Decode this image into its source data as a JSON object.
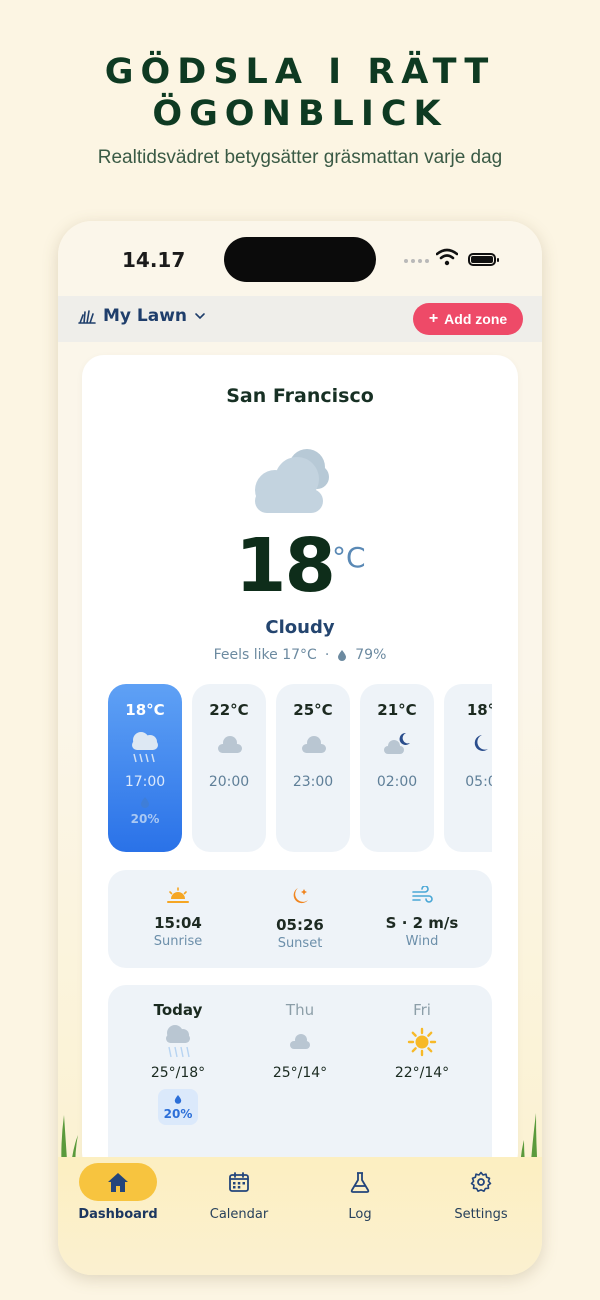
{
  "header": {
    "title_line1": "GÖDSLA I RÄTT",
    "title_line2": "ÖGONBLICK",
    "subtitle": "Realtidsvädret betygsätter gräsmattan varje dag"
  },
  "status_bar": {
    "time": "14.17"
  },
  "top_bar": {
    "lawn_name": "My Lawn",
    "add_zone_label": "Add zone",
    "icons": [
      "lawn-icon",
      "chevron-down-icon",
      "plus-icon"
    ]
  },
  "weather": {
    "city": "San Francisco",
    "temperature": "18",
    "unit": "°C",
    "condition": "Cloudy",
    "feels_like": "Feels like 17°C",
    "separator": "·",
    "humidity": "79%"
  },
  "hourly": [
    {
      "temp": "18°C",
      "time": "17:00",
      "precip": "20%",
      "icon": "rain-cloud-icon",
      "active": true
    },
    {
      "temp": "22°C",
      "time": "20:00",
      "icon": "cloud-icon"
    },
    {
      "temp": "25°C",
      "time": "23:00",
      "icon": "cloud-icon"
    },
    {
      "temp": "21°C",
      "time": "02:00",
      "icon": "cloud-moon-icon"
    },
    {
      "temp": "18°",
      "time": "05:0",
      "icon": "moon-icon"
    }
  ],
  "sun_wind": [
    {
      "value": "15:04",
      "label": "Sunrise",
      "icon": "sunrise-icon"
    },
    {
      "value": "05:26",
      "label": "Sunset",
      "icon": "sunset-icon"
    },
    {
      "value": "S · 2 m/s",
      "label": "Wind",
      "icon": "wind-icon"
    }
  ],
  "daily": [
    {
      "day": "Today",
      "temps": "25°/18°",
      "precip": "20%",
      "icon": "rain-cloud-icon"
    },
    {
      "day": "Thu",
      "temps": "25°/14°",
      "icon": "cloud-icon"
    },
    {
      "day": "Fri",
      "temps": "22°/14°",
      "icon": "sun-icon"
    }
  ],
  "tabs": [
    {
      "label": "Dashboard",
      "icon": "home-icon",
      "active": true
    },
    {
      "label": "Calendar",
      "icon": "calendar-icon"
    },
    {
      "label": "Log",
      "icon": "flask-icon"
    },
    {
      "label": "Settings",
      "icon": "gear-icon"
    }
  ],
  "colors": {
    "accent": "#ee4a68",
    "active_hour": "#2a72e8",
    "tab_active": "#f7c43f",
    "headline": "#0e3a22"
  }
}
